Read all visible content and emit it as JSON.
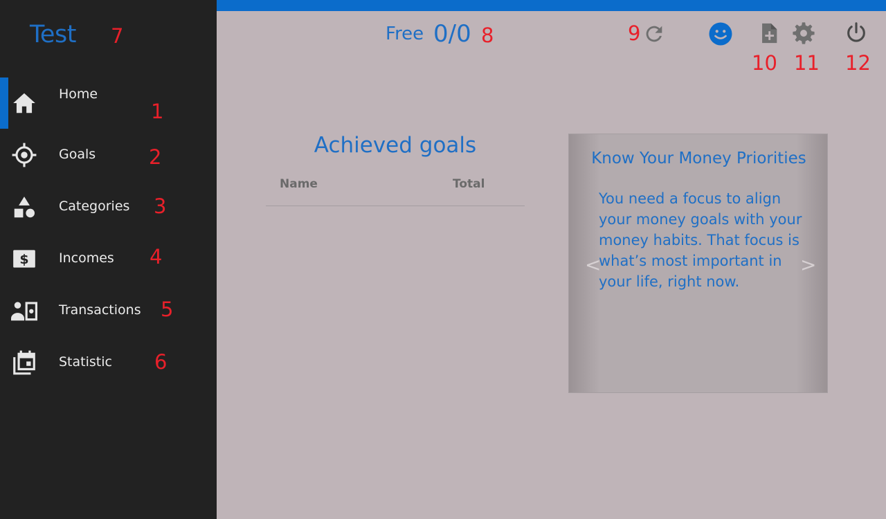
{
  "sidebar": {
    "app_title": "Test",
    "items": [
      {
        "label": "Home",
        "icon": "home-icon",
        "active": true
      },
      {
        "label": "Goals",
        "icon": "crosshair-icon",
        "active": false
      },
      {
        "label": "Categories",
        "icon": "shapes-icon",
        "active": false
      },
      {
        "label": "Incomes",
        "icon": "money-icon",
        "active": false
      },
      {
        "label": "Transactions",
        "icon": "transactions-icon",
        "active": false
      },
      {
        "label": "Statistic",
        "icon": "calendar-icon",
        "active": false
      }
    ]
  },
  "header": {
    "plan_label": "Free",
    "plan_count": "0/0"
  },
  "toolbar": {
    "icons": [
      "refresh-icon",
      "smiley-icon",
      "add-document-icon",
      "settings-icon",
      "power-icon"
    ]
  },
  "annotations": [
    "1",
    "2",
    "3",
    "4",
    "5",
    "6",
    "7",
    "8",
    "9",
    "10",
    "11",
    "12"
  ],
  "goals": {
    "title": "Achieved goals",
    "columns": [
      "Name",
      "Total"
    ]
  },
  "card": {
    "title": "Know Your Money Priorities",
    "body": "You need a focus to align your money goals with your money habits. That focus is what’s most important in your life, right now.",
    "prev_label": "<",
    "next_label": ">"
  },
  "colors": {
    "accent": "#0b6ccb",
    "text_blue": "#1f6fc5",
    "sidebar_bg": "#222222",
    "main_bg": "#bfb4b8",
    "annotation_red": "#e8202a"
  }
}
